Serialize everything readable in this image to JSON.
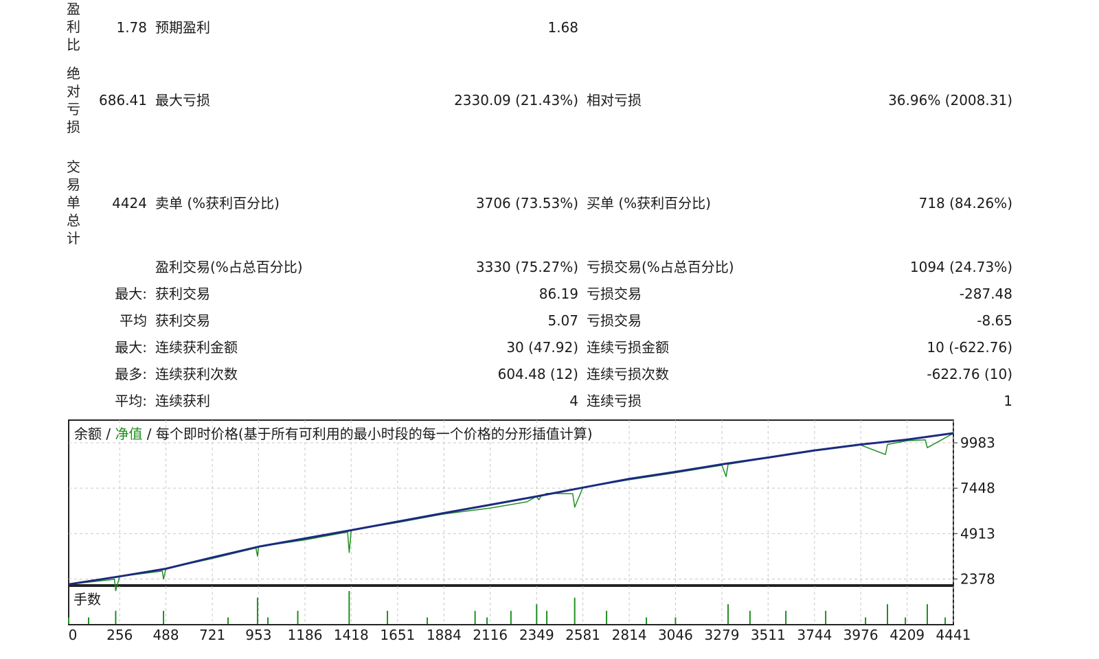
{
  "stats": {
    "row1": {
      "vlabel": "盈利比",
      "value": "1.78",
      "label": "预期盈利",
      "mid_value": "1.68"
    },
    "row2": {
      "vlabel": "绝对亏损",
      "value": "686.41",
      "label": "最大亏损",
      "mid_value": "2330.09 (21.43%)",
      "label2": "相对亏损",
      "right_value": "36.96% (2008.31)"
    },
    "row3": {
      "vlabel": "交易单总计",
      "value": "4424",
      "label": "卖单 (%获利百分比)",
      "mid_value": "3706 (73.53%)",
      "label2": "买单 (%获利百分比)",
      "right_value": "718 (84.26%)"
    },
    "row4": {
      "label": "盈利交易(%占总百分比)",
      "mid_value": "3330 (75.27%)",
      "label2": "亏损交易(%占总百分比)",
      "right_value": "1094 (24.73%)"
    },
    "row5": {
      "prefix": "最大:",
      "label": "获利交易",
      "mid_value": "86.19",
      "label2": "亏损交易",
      "right_value": "-287.48"
    },
    "row6": {
      "prefix": "平均",
      "label": "获利交易",
      "mid_value": "5.07",
      "label2": "亏损交易",
      "right_value": "-8.65"
    },
    "row7": {
      "prefix": "最大:",
      "label": "连续获利金额",
      "mid_value": "30 (47.92)",
      "label2": "连续亏损金额",
      "right_value": "10 (-622.76)"
    },
    "row8": {
      "prefix": "最多:",
      "label": "连续获利次数",
      "mid_value": "604.48 (12)",
      "label2": "连续亏损次数",
      "right_value": "-622.76 (10)"
    },
    "row9": {
      "prefix": "平均:",
      "label": "连续获利",
      "mid_value": "4",
      "label2": "连续亏损",
      "right_value": "1"
    }
  },
  "legend": {
    "balance": "余额",
    "sep1": " / ",
    "equity": "净值",
    "sep2": " / ",
    "desc": "每个即时价格(基于所有可利用的最小时段的每一个价格的分形插值计算)"
  },
  "colors": {
    "balance": "#1b2a80",
    "equity": "#1f8f1f",
    "volume": "#1f8f1f",
    "grid": "#c8c8c8"
  },
  "chart_data": {
    "type": "line",
    "y_ticks": [
      9983,
      7448,
      4913,
      2378
    ],
    "ylim": [
      2050,
      11250
    ],
    "x_ticks": [
      0,
      256,
      488,
      721,
      953,
      1186,
      1418,
      1651,
      1884,
      2116,
      2349,
      2581,
      2814,
      3046,
      3279,
      3511,
      3744,
      3976,
      4209,
      4441
    ],
    "xlim": [
      0,
      4441
    ],
    "grid": true,
    "series": [
      {
        "name": "余额",
        "x": [
          0,
          256,
          488,
          721,
          953,
          1186,
          1418,
          1651,
          1884,
          2116,
          2349,
          2581,
          2814,
          3046,
          3279,
          3511,
          3744,
          3976,
          4209,
          4441
        ],
        "y": [
          2080,
          2520,
          2950,
          3580,
          4180,
          4640,
          5100,
          5580,
          6060,
          6520,
          6990,
          7480,
          7970,
          8360,
          8780,
          9160,
          9560,
          9890,
          10160,
          10520
        ]
      },
      {
        "name": "净值",
        "x": [
          0,
          230,
          236,
          256,
          470,
          476,
          488,
          721,
          940,
          948,
          953,
          1186,
          1400,
          1408,
          1418,
          1651,
          1884,
          2116,
          2300,
          2349,
          2360,
          2370,
          2400,
          2530,
          2540,
          2581,
          2814,
          3046,
          3279,
          3300,
          3310,
          3511,
          3744,
          3976,
          4100,
          4110,
          4209,
          4300,
          4310,
          4441
        ],
        "y": [
          2080,
          2360,
          1720,
          2520,
          2820,
          2380,
          2950,
          3520,
          4110,
          3650,
          4180,
          4560,
          5000,
          3860,
          5100,
          5530,
          6010,
          6340,
          6690,
          6990,
          6800,
          6990,
          7160,
          7140,
          6390,
          7480,
          7920,
          8310,
          8730,
          8100,
          8780,
          9140,
          9530,
          9860,
          9330,
          9890,
          10100,
          10150,
          9710,
          10510
        ]
      }
    ],
    "volume": {
      "label": "手数",
      "x": [
        0,
        100,
        236,
        476,
        800,
        948,
        1000,
        1150,
        1408,
        1600,
        1800,
        2040,
        2100,
        2220,
        2349,
        2400,
        2540,
        2700,
        2900,
        3046,
        3310,
        3420,
        3600,
        3800,
        4000,
        4110,
        4200,
        4310,
        4400
      ],
      "y": [
        1,
        1,
        2,
        2,
        1,
        4,
        1,
        2,
        5,
        2,
        1,
        2,
        1,
        2,
        3,
        2,
        4,
        2,
        1,
        1,
        3,
        2,
        2,
        2,
        1,
        3,
        1,
        3,
        1
      ]
    }
  }
}
